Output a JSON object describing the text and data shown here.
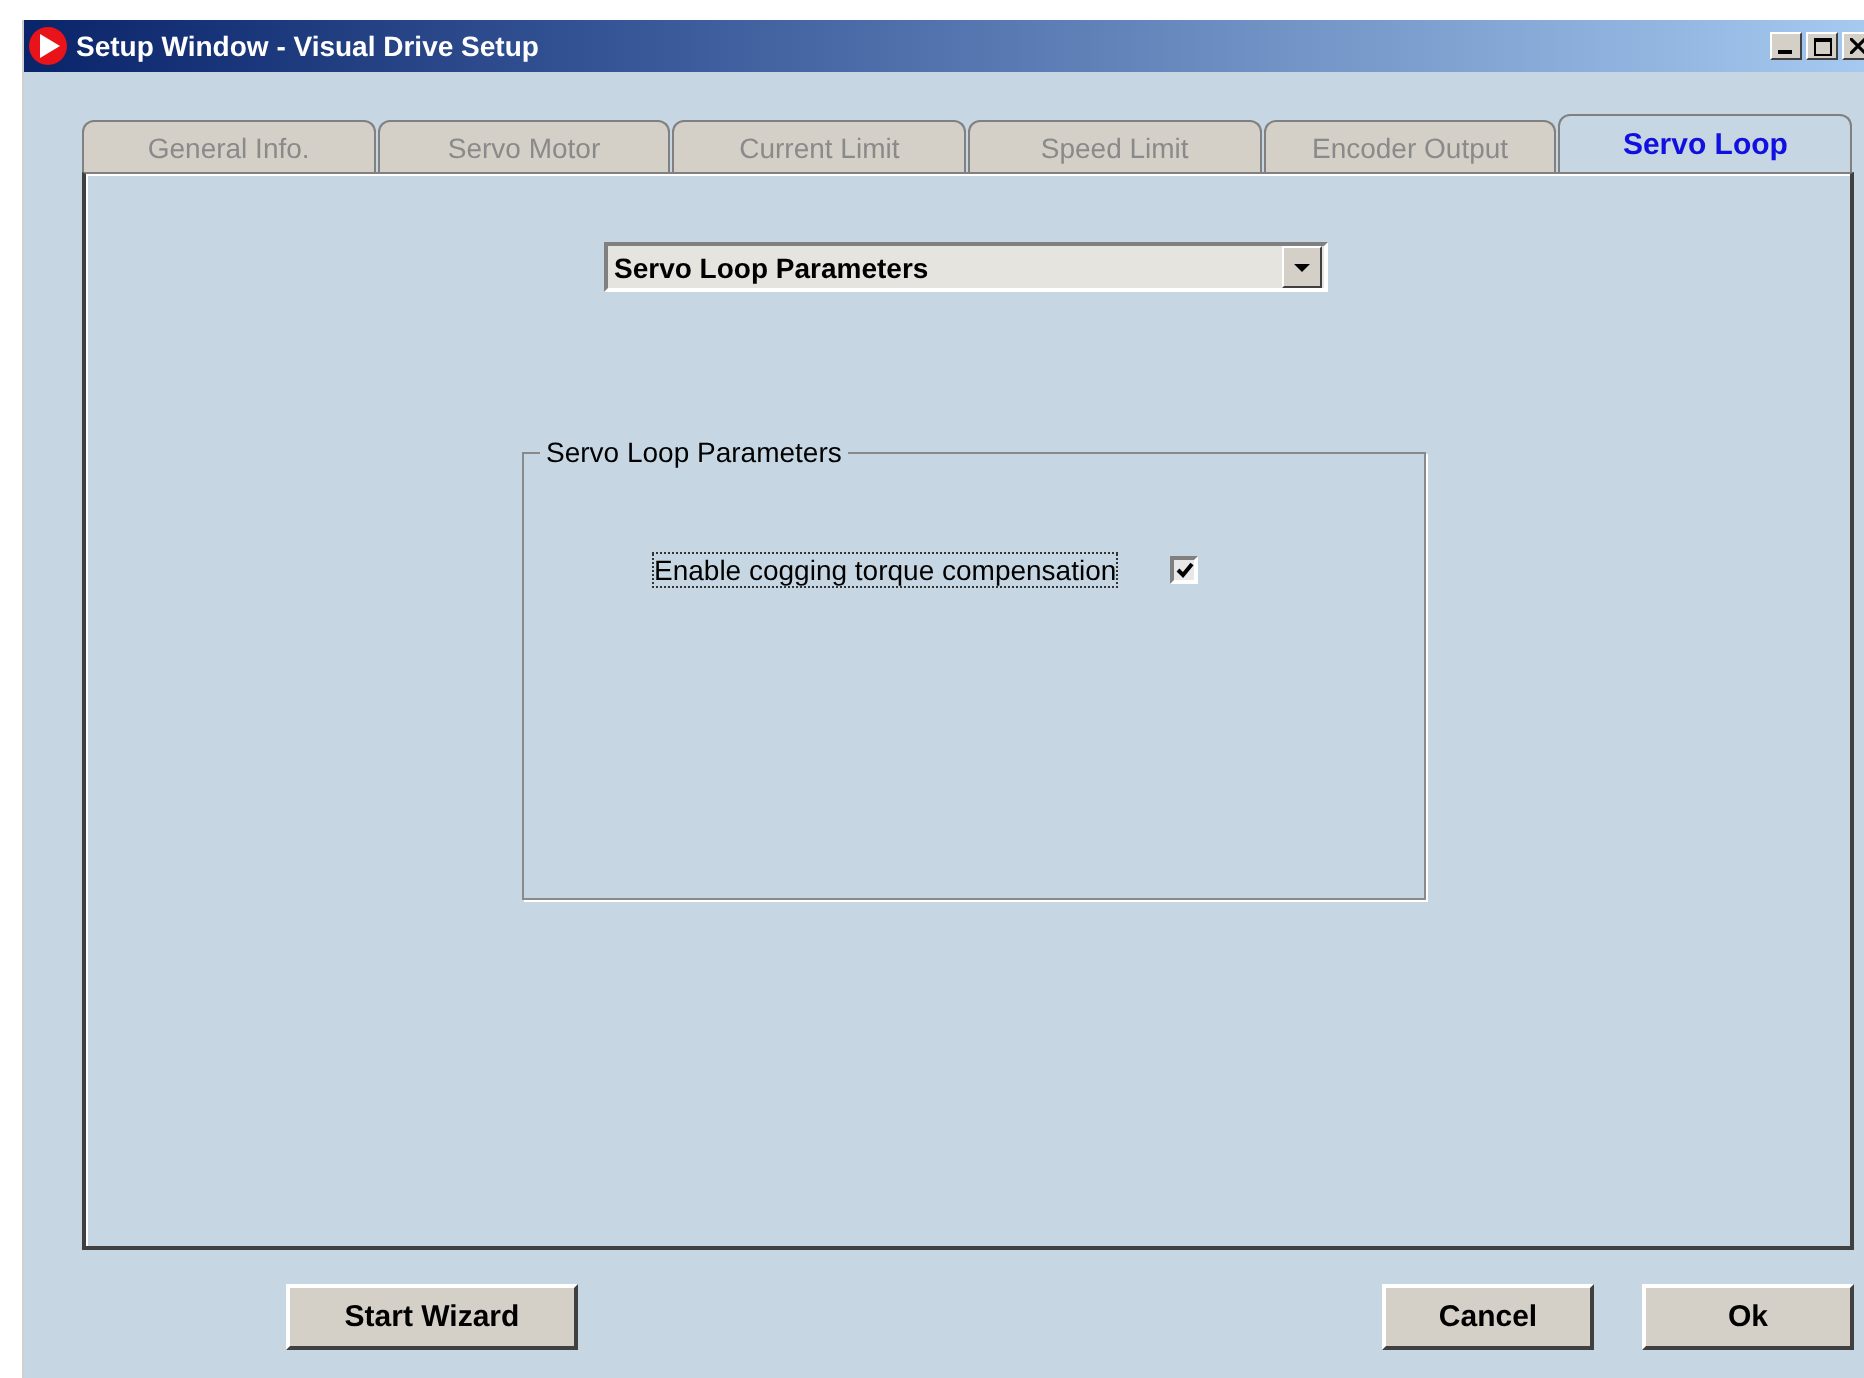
{
  "window": {
    "title": "Setup Window - Visual Drive Setup"
  },
  "tabs": [
    {
      "label": "General Info.",
      "selected": false
    },
    {
      "label": "Servo Motor",
      "selected": false
    },
    {
      "label": "Current Limit",
      "selected": false
    },
    {
      "label": "Speed Limit",
      "selected": false
    },
    {
      "label": "Encoder Output",
      "selected": false
    },
    {
      "label": "Servo Loop",
      "selected": true
    }
  ],
  "dropdown": {
    "value": "Servo Loop Parameters"
  },
  "group": {
    "title": "Servo Loop Parameters",
    "checkbox": {
      "label": "Enable cogging torque compensation",
      "checked": true
    }
  },
  "buttons_left": [
    "Start Wizard"
  ],
  "buttons_right": [
    "Cancel",
    "Ok"
  ]
}
